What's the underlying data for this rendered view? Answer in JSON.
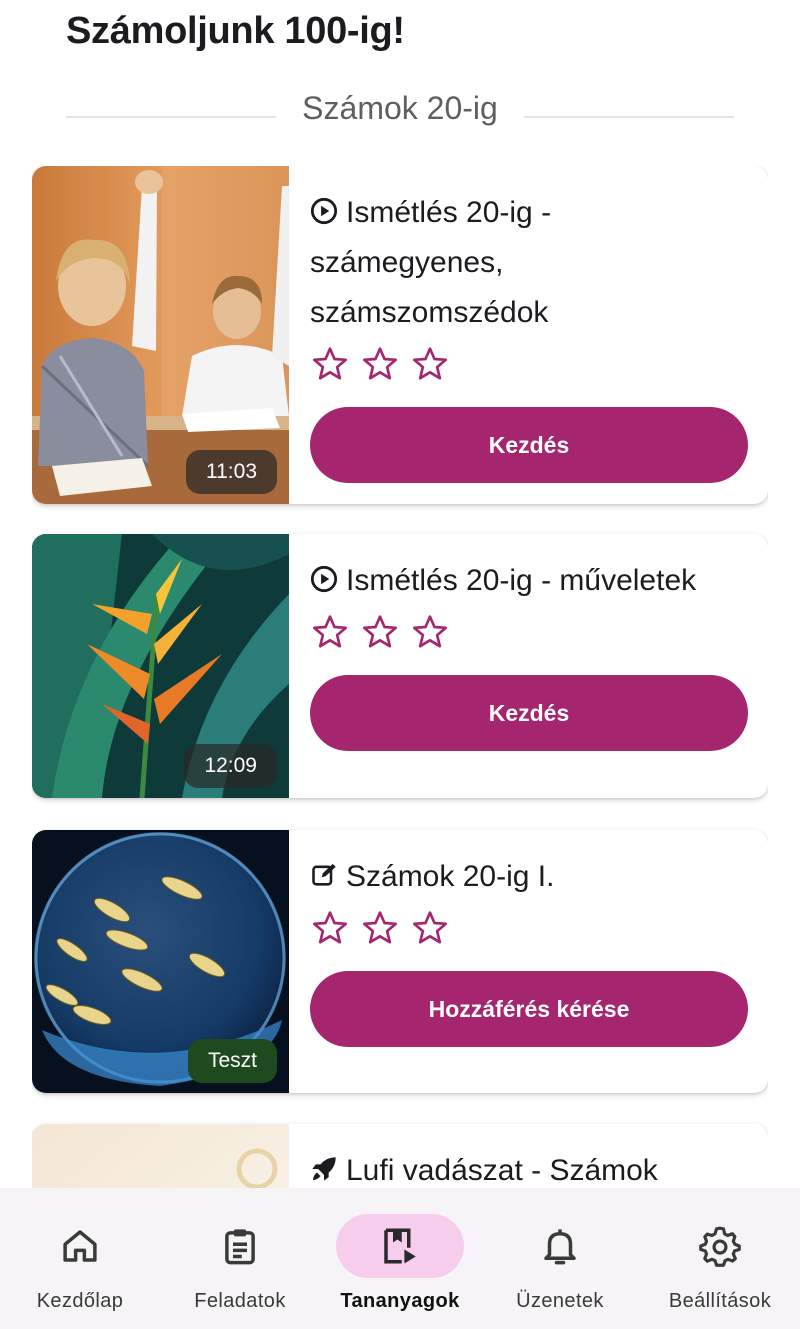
{
  "header": {
    "title": "Számoljunk 100-ig!"
  },
  "section": {
    "title": "Számok 20-ig"
  },
  "cards": [
    {
      "icon": "play-circle-icon",
      "title": "Ismétlés 20-ig - számegyenes, számszomszédok",
      "badge": "11:03",
      "rating": 0,
      "rating_max": 3,
      "button": "Kezdés"
    },
    {
      "icon": "play-circle-icon",
      "title": "Ismétlés 20-ig - műveletek",
      "badge": "12:09",
      "rating": 0,
      "rating_max": 3,
      "button": "Kezdés"
    },
    {
      "icon": "edit-icon",
      "title": "Számok 20-ig I.",
      "badge": "Teszt",
      "rating": 0,
      "rating_max": 3,
      "button": "Hozzáférés kérése"
    },
    {
      "icon": "rocket-icon",
      "title": "Lufi vadászat - Számok"
    }
  ],
  "nav": {
    "items": [
      {
        "icon": "home-icon",
        "label": "Kezdőlap",
        "active": false
      },
      {
        "icon": "clipboard-icon",
        "label": "Feladatok",
        "active": false
      },
      {
        "icon": "book-play-icon",
        "label": "Tananyagok",
        "active": true
      },
      {
        "icon": "bell-icon",
        "label": "Üzenetek",
        "active": false
      },
      {
        "icon": "gear-icon",
        "label": "Beállítások",
        "active": false
      }
    ]
  },
  "colors": {
    "accent": "#a5256f",
    "star": "#a5256f",
    "nav_active_bg": "#f7cdee",
    "nav_bg": "#f6f4f6"
  }
}
